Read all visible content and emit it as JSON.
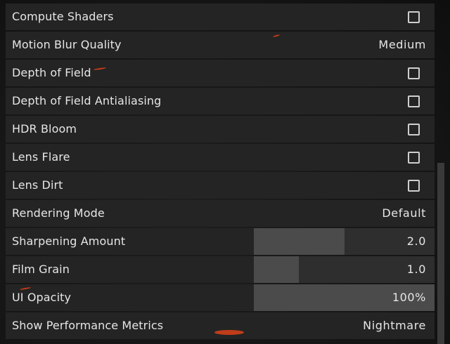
{
  "settings": {
    "rows": [
      {
        "label": "Compute Shaders",
        "type": "checkbox",
        "checked": false
      },
      {
        "label": "Motion Blur Quality",
        "type": "select",
        "value": "Medium"
      },
      {
        "label": "Depth of Field",
        "type": "checkbox",
        "checked": false
      },
      {
        "label": "Depth of Field Antialiasing",
        "type": "checkbox",
        "checked": false
      },
      {
        "label": "HDR Bloom",
        "type": "checkbox",
        "checked": false
      },
      {
        "label": "Lens Flare",
        "type": "checkbox",
        "checked": false
      },
      {
        "label": "Lens Dirt",
        "type": "checkbox",
        "checked": false
      },
      {
        "label": "Rendering Mode",
        "type": "select",
        "value": "Default"
      },
      {
        "label": "Sharpening Amount",
        "type": "slider",
        "value": "2.0",
        "fill_fraction": 0.5
      },
      {
        "label": "Film Grain",
        "type": "slider",
        "value": "1.0",
        "fill_fraction": 0.25
      },
      {
        "label": "UI Opacity",
        "type": "slider",
        "value": "100%",
        "fill_fraction": 1.0
      },
      {
        "label": "Show Performance Metrics",
        "type": "select",
        "value": "Nightmare"
      }
    ]
  },
  "colors": {
    "row_background": "#242424",
    "slider_fill": "#4b4b4b",
    "slider_track": "#2e2e2e",
    "text": "#e6e6e6",
    "ember_accent": "#d2401a"
  }
}
